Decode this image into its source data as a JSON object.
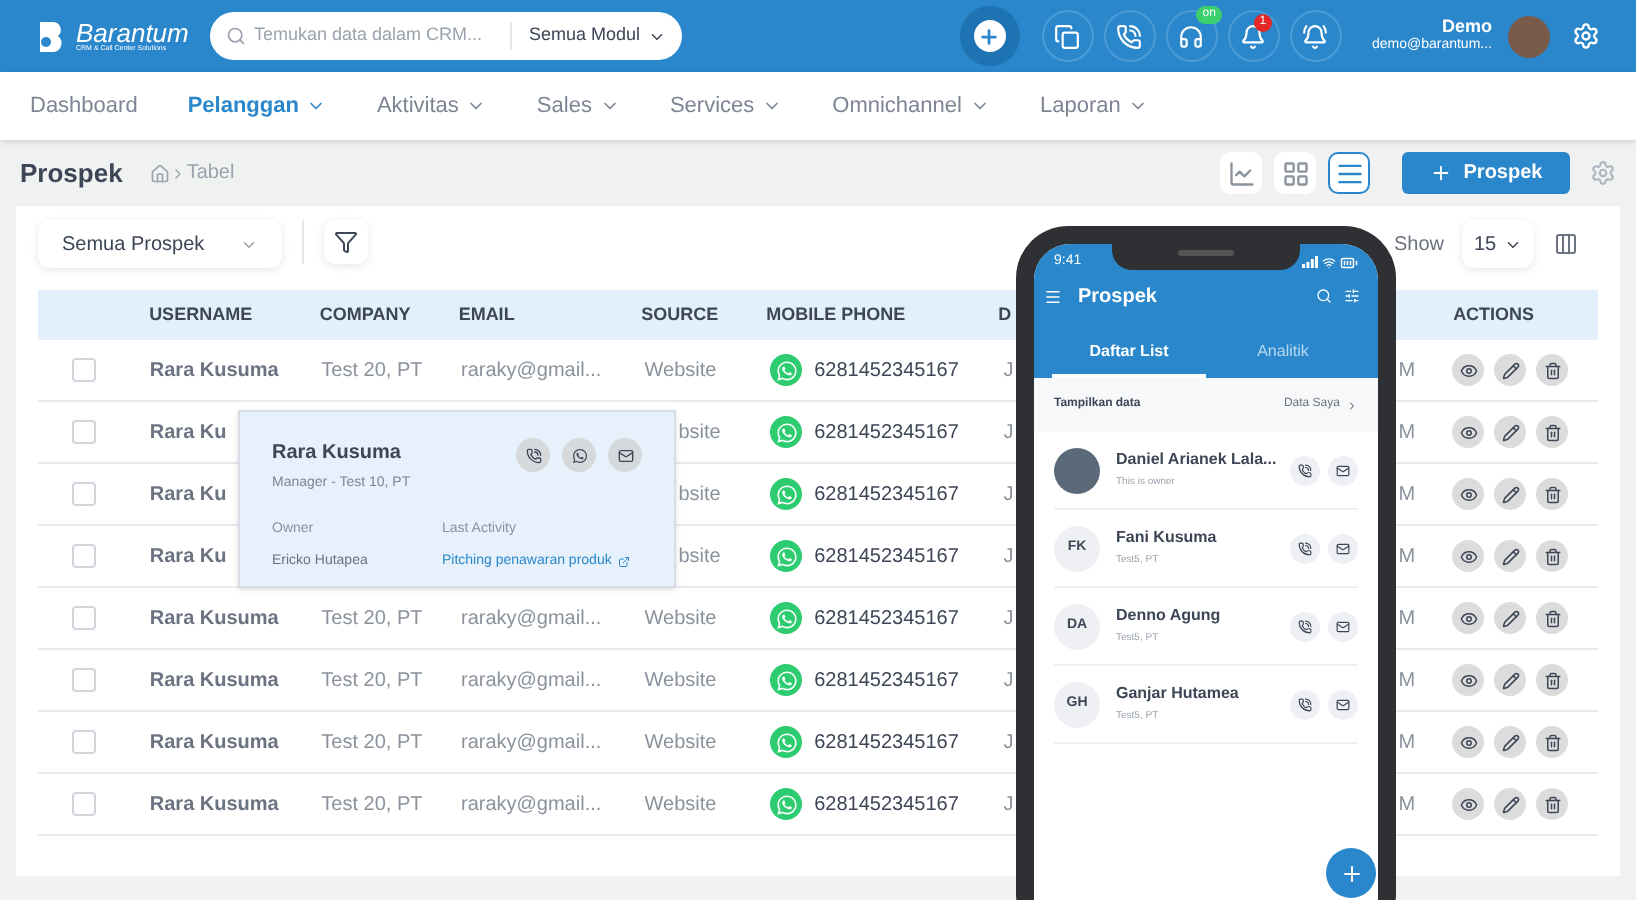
{
  "header": {
    "logo": {
      "name": "Barantum",
      "tagline": "CRM & Call Center Solutions"
    },
    "search": {
      "placeholder": "Temukan data dalam CRM...",
      "module": "Semua Modul"
    },
    "call_badge": "on",
    "notification_badge": "1",
    "user": {
      "name": "Demo",
      "email": "demo@barantum..."
    }
  },
  "nav": [
    {
      "label": "Dashboard",
      "selected": false,
      "dropdown": false
    },
    {
      "label": "Pelanggan",
      "selected": true,
      "dropdown": true
    },
    {
      "label": "Aktivitas",
      "selected": false,
      "dropdown": true
    },
    {
      "label": "Sales",
      "selected": false,
      "dropdown": true
    },
    {
      "label": "Services",
      "selected": false,
      "dropdown": true
    },
    {
      "label": "Omnichannel",
      "selected": false,
      "dropdown": true
    },
    {
      "label": "Laporan",
      "selected": false,
      "dropdown": true
    }
  ],
  "page": {
    "title": "Prospek",
    "breadcrumb": "Tabel",
    "view_buttons": [
      {
        "kind": "chart",
        "selected": false
      },
      {
        "kind": "grid",
        "selected": false
      },
      {
        "kind": "list",
        "selected": true
      }
    ],
    "add_button": "Prospek"
  },
  "toolbar": {
    "filter": "Semua Prospek",
    "show_label": "Show",
    "page_size": "15"
  },
  "table": {
    "columns": [
      "USERNAME",
      "COMPANY",
      "EMAIL",
      "SOURCE",
      "MOBILE PHONE",
      "D",
      "ACTIONS"
    ],
    "rows": [
      {
        "checked": false,
        "username": "Rara Kusuma",
        "company": "Test 20, PT",
        "email": "raraky@gmail...",
        "source": "Website",
        "phone": "6281452345167",
        "column_6": "J",
        "column_7": "M"
      },
      {
        "checked": false,
        "username": "Rara Ku",
        "source": "bsite",
        "phone": "6281452345167",
        "column_6": "J",
        "column_7": "M"
      },
      {
        "checked": false,
        "username": "Rara Ku",
        "source": "bsite",
        "phone": "6281452345167",
        "column_6": "J",
        "column_7": "M"
      },
      {
        "checked": false,
        "username": "Rara Ku",
        "source": "bsite",
        "phone": "6281452345167",
        "column_6": "J",
        "column_7": "M"
      },
      {
        "checked": false,
        "username": "Rara Kusuma",
        "company": "Test 20, PT",
        "email": "raraky@gmail...",
        "source": "Website",
        "phone": "6281452345167",
        "column_6": "J",
        "column_7": "M"
      },
      {
        "checked": false,
        "username": "Rara Kusuma",
        "company": "Test 20, PT",
        "email": "raraky@gmail...",
        "source": "Website",
        "phone": "6281452345167",
        "column_6": "J",
        "column_7": "M"
      },
      {
        "checked": false,
        "username": "Rara Kusuma",
        "company": "Test 20, PT",
        "email": "raraky@gmail...",
        "source": "Website",
        "phone": "6281452345167",
        "column_6": "J",
        "column_7": "M"
      },
      {
        "checked": false,
        "username": "Rara Kusuma",
        "company": "Test 20, PT",
        "email": "raraky@gmail...",
        "source": "Website",
        "phone": "6281452345167",
        "column_6": "J",
        "column_7": "M"
      }
    ]
  },
  "popup": {
    "name": "Rara Kusuma",
    "role": "Manager - Test 10, PT",
    "owner_label": "Owner",
    "owner": "Ericko Hutapea",
    "activity_label": "Last Activity",
    "activity": "Pitching penawaran produk"
  },
  "phone": {
    "time": "9:41",
    "title": "Prospek",
    "tabs": [
      {
        "label": "Daftar List",
        "selected": true
      },
      {
        "label": "Analitik",
        "selected": false
      }
    ],
    "filter_label": "Tampilkan data",
    "filter_value": "Data Saya",
    "contacts": [
      {
        "kind": "photo",
        "name": "Daniel Arianek Lala...",
        "subtitle": "This is owner"
      },
      {
        "kind": "initials",
        "initials": "FK",
        "name": "Fani Kusuma",
        "subtitle": "Test5, PT"
      },
      {
        "kind": "initials",
        "initials": "DA",
        "name": "Denno Agung",
        "subtitle": "Test5, PT"
      },
      {
        "kind": "initials",
        "initials": "GH",
        "name": "Ganjar Hutamea",
        "subtitle": "Test5, PT"
      }
    ]
  }
}
